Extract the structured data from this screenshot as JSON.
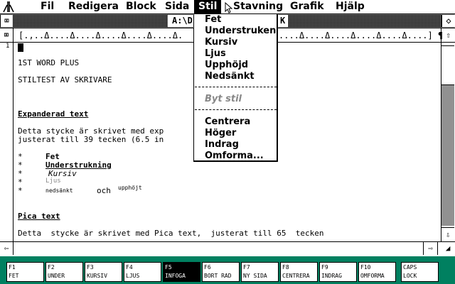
{
  "menubar": {
    "items": [
      {
        "label": "Fil"
      },
      {
        "label": "Redigera"
      },
      {
        "label": "Block"
      },
      {
        "label": "Sida"
      },
      {
        "label": "Stil"
      },
      {
        "label": "Stavning"
      },
      {
        "label": "Grafik"
      },
      {
        "label": "Hjälp"
      }
    ],
    "active": "Stil"
  },
  "window": {
    "title": "A:\\D",
    "title_tail": "K",
    "close_icon": "close-box-icon",
    "full_icon": "full-box-icon"
  },
  "ruler": {
    "text": "[.,..Δ....Δ....Δ....Δ....Δ....Δ....Δ....Δ....Δ....Δ....Δ....Δ....Δ....] ¶",
    "left_visible": "[.,..Δ....Δ....Δ....Δ....Δ....Δ.",
    "right_visible": "....Δ....Δ....Δ....Δ....Δ....] ¶"
  },
  "gutter": {
    "line_number": "1"
  },
  "document": {
    "line1": "1ST WORD PLUS",
    "line2": "STILTEST AV SKRIVARE",
    "heading1": "Expanderad text",
    "para1a": "Detta stycke är skrivet med exp",
    "para1b": "justerat till 39 tecken (6.5 in",
    "bullets": [
      {
        "marker": "*",
        "text": "Fet"
      },
      {
        "marker": "*",
        "text": "Understrukning"
      },
      {
        "marker": "*",
        "text": "Kursiv"
      },
      {
        "marker": "*",
        "text": "Ljus"
      },
      {
        "marker": "*",
        "text_a": "nedsänkt",
        "text_b": "och",
        "text_c": "upphöjt"
      }
    ],
    "heading2": "Pica text",
    "para2": "Detta  stycke är skrivet med Pica text,  justerat till 65  tecken"
  },
  "dropdown": {
    "items_top": [
      "Fet",
      "Understruken",
      "Kursiv",
      "Ljus",
      "Upphöjd",
      "Nedsänkt"
    ],
    "item_disabled": "Byt stil",
    "items_bottom": [
      "Centrera",
      "Höger",
      "Indrag",
      "Omforma..."
    ]
  },
  "fkeys": [
    {
      "key": "F1",
      "label": "FET"
    },
    {
      "key": "F2",
      "label": "UNDER"
    },
    {
      "key": "F3",
      "label": "KURSIV"
    },
    {
      "key": "F4",
      "label": "LJUS"
    },
    {
      "key": "F5",
      "label": "INFOGA"
    },
    {
      "key": "F6",
      "label": "BORT RAD"
    },
    {
      "key": "F7",
      "label": "NY SIDA"
    },
    {
      "key": "F8",
      "label": "CENTRERA"
    },
    {
      "key": "F9",
      "label": "INDRAG"
    },
    {
      "key": "F10",
      "label": "OMFORMA"
    },
    {
      "key": "CAPS",
      "label": "LOCK"
    }
  ],
  "colors": {
    "fkeybar": "#008060",
    "menu_active": "#000000"
  }
}
